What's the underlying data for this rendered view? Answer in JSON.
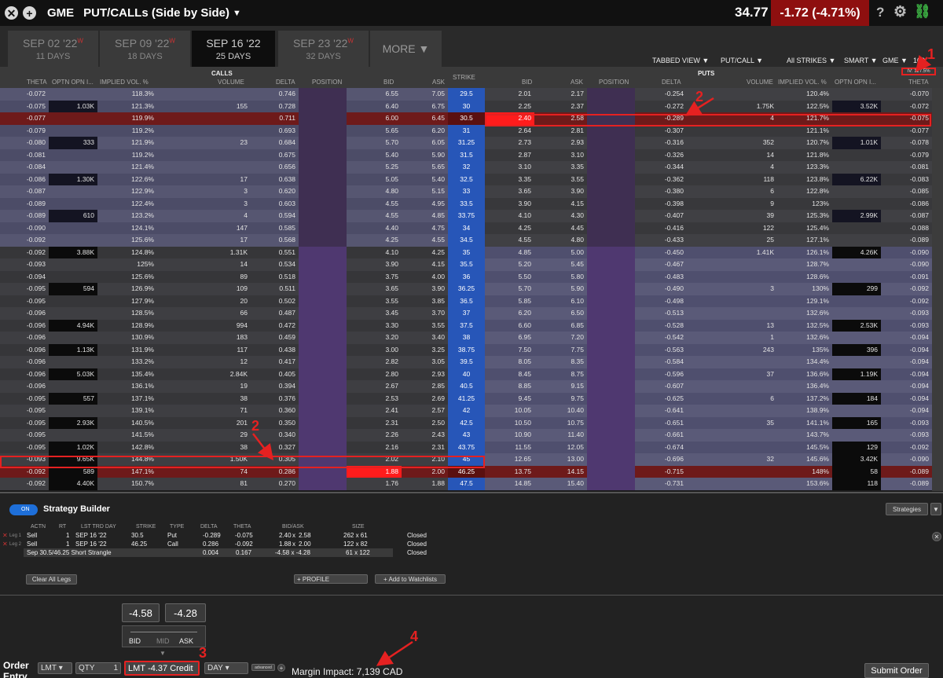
{
  "topbar": {
    "close_glyph": "✕",
    "add_glyph": "+",
    "symbol": "GME",
    "view": "PUT/CALLs (Side by Side)",
    "price": "34.77",
    "change": "-1.72 (-4.71%)",
    "help": "?"
  },
  "tabs": [
    {
      "date": "SEP 02 '22",
      "w": "W",
      "days": "11 DAYS"
    },
    {
      "date": "SEP 09 '22",
      "w": "W",
      "days": "18 DAYS"
    },
    {
      "date": "SEP 16 '22",
      "w": "",
      "days": "25 DAYS"
    },
    {
      "date": "SEP 23 '22",
      "w": "W",
      "days": "32 DAYS"
    }
  ],
  "more": "MORE ▼",
  "options": {
    "tabbed": "TABBED VIEW ▼",
    "putcall": "PUT/CALL ▼",
    "strikes": "All STRIKES ▼",
    "smart": "SMART ▼",
    "gme": "GME ▼",
    "mult": "100",
    "iv": "IV: 127.5%"
  },
  "headers": {
    "calls": "CALLS",
    "puts": "PUTS",
    "strike": "STRIKE",
    "c_theta": "THETA",
    "c_oi": "OPTN OPN I...",
    "c_iv": "IMPLIED VOL. %",
    "c_vol": "VOLUME",
    "c_delta": "DELTA",
    "c_pos": "POSITION",
    "c_bid": "BID",
    "c_ask": "ASK",
    "p_bid": "BID",
    "p_ask": "ASK",
    "p_pos": "POSITION",
    "p_delta": "DELTA",
    "p_vol": "VOLUME",
    "p_iv": "IMPLIED VOL. %",
    "p_oi": "OPTN OPN I...",
    "p_theta": "THETA"
  },
  "rows": [
    [
      "-0.072",
      "",
      "118.3%",
      "",
      "0.746",
      "6.55",
      "7.05",
      "29.5",
      "2.01",
      "2.17",
      "-0.254",
      "",
      "120.4%",
      "",
      "-0.070"
    ],
    [
      "-0.075",
      "1.03K",
      "121.3%",
      "155",
      "0.728",
      "6.40",
      "6.75",
      "30",
      "2.25",
      "2.37",
      "-0.272",
      "1.75K",
      "122.5%",
      "3.52K",
      "-0.072"
    ],
    [
      "-0.077",
      "",
      "119.9%",
      "",
      "0.711",
      "6.00",
      "6.45",
      "30.5",
      "2.40",
      "2.58",
      "-0.289",
      "4",
      "121.7%",
      "",
      "-0.075"
    ],
    [
      "-0.079",
      "",
      "119.2%",
      "",
      "0.693",
      "5.65",
      "6.20",
      "31",
      "2.64",
      "2.81",
      "-0.307",
      "",
      "121.1%",
      "",
      "-0.077"
    ],
    [
      "-0.080",
      "333",
      "121.9%",
      "23",
      "0.684",
      "5.70",
      "6.05",
      "31.25",
      "2.73",
      "2.93",
      "-0.316",
      "352",
      "120.7%",
      "1.01K",
      "-0.078"
    ],
    [
      "-0.081",
      "",
      "119.2%",
      "",
      "0.675",
      "5.40",
      "5.90",
      "31.5",
      "2.87",
      "3.10",
      "-0.326",
      "14",
      "121.8%",
      "",
      "-0.079"
    ],
    [
      "-0.084",
      "",
      "121.4%",
      "",
      "0.656",
      "5.25",
      "5.65",
      "32",
      "3.10",
      "3.35",
      "-0.344",
      "4",
      "123.3%",
      "",
      "-0.081"
    ],
    [
      "-0.086",
      "1.30K",
      "122.6%",
      "17",
      "0.638",
      "5.05",
      "5.40",
      "32.5",
      "3.35",
      "3.55",
      "-0.362",
      "118",
      "123.8%",
      "6.22K",
      "-0.083"
    ],
    [
      "-0.087",
      "",
      "122.9%",
      "3",
      "0.620",
      "4.80",
      "5.15",
      "33",
      "3.65",
      "3.90",
      "-0.380",
      "6",
      "122.8%",
      "",
      "-0.085"
    ],
    [
      "-0.089",
      "",
      "122.4%",
      "3",
      "0.603",
      "4.55",
      "4.95",
      "33.5",
      "3.90",
      "4.15",
      "-0.398",
      "9",
      "123%",
      "",
      "-0.086"
    ],
    [
      "-0.089",
      "610",
      "123.2%",
      "4",
      "0.594",
      "4.55",
      "4.85",
      "33.75",
      "4.10",
      "4.30",
      "-0.407",
      "39",
      "125.3%",
      "2.99K",
      "-0.087"
    ],
    [
      "-0.090",
      "",
      "124.1%",
      "147",
      "0.585",
      "4.40",
      "4.75",
      "34",
      "4.25",
      "4.45",
      "-0.416",
      "122",
      "125.4%",
      "",
      "-0.088"
    ],
    [
      "-0.092",
      "",
      "125.6%",
      "17",
      "0.568",
      "4.25",
      "4.55",
      "34.5",
      "4.55",
      "4.80",
      "-0.433",
      "25",
      "127.1%",
      "",
      "-0.089"
    ],
    [
      "-0.092",
      "3.88K",
      "124.8%",
      "1.31K",
      "0.551",
      "4.10",
      "4.25",
      "35",
      "4.85",
      "5.00",
      "-0.450",
      "1.41K",
      "126.1%",
      "4.26K",
      "-0.090"
    ],
    [
      "-0.093",
      "",
      "125%",
      "14",
      "0.534",
      "3.90",
      "4.15",
      "35.5",
      "5.20",
      "5.45",
      "-0.467",
      "",
      "128.7%",
      "",
      "-0.090"
    ],
    [
      "-0.094",
      "",
      "125.6%",
      "89",
      "0.518",
      "3.75",
      "4.00",
      "36",
      "5.50",
      "5.80",
      "-0.483",
      "",
      "128.6%",
      "",
      "-0.091"
    ],
    [
      "-0.095",
      "594",
      "126.9%",
      "109",
      "0.511",
      "3.65",
      "3.90",
      "36.25",
      "5.70",
      "5.90",
      "-0.490",
      "3",
      "130%",
      "299",
      "-0.092"
    ],
    [
      "-0.095",
      "",
      "127.9%",
      "20",
      "0.502",
      "3.55",
      "3.85",
      "36.5",
      "5.85",
      "6.10",
      "-0.498",
      "",
      "129.1%",
      "",
      "-0.092"
    ],
    [
      "-0.096",
      "",
      "128.5%",
      "66",
      "0.487",
      "3.45",
      "3.70",
      "37",
      "6.20",
      "6.50",
      "-0.513",
      "",
      "132.6%",
      "",
      "-0.093"
    ],
    [
      "-0.096",
      "4.94K",
      "128.9%",
      "994",
      "0.472",
      "3.30",
      "3.55",
      "37.5",
      "6.60",
      "6.85",
      "-0.528",
      "13",
      "132.5%",
      "2.53K",
      "-0.093"
    ],
    [
      "-0.096",
      "",
      "130.9%",
      "183",
      "0.459",
      "3.20",
      "3.40",
      "38",
      "6.95",
      "7.20",
      "-0.542",
      "1",
      "132.6%",
      "",
      "-0.094"
    ],
    [
      "-0.096",
      "1.13K",
      "131.9%",
      "117",
      "0.438",
      "3.00",
      "3.25",
      "38.75",
      "7.50",
      "7.75",
      "-0.563",
      "243",
      "135%",
      "396",
      "-0.094"
    ],
    [
      "-0.096",
      "",
      "133.2%",
      "12",
      "0.417",
      "2.82",
      "3.05",
      "39.5",
      "8.05",
      "8.35",
      "-0.584",
      "",
      "134.4%",
      "",
      "-0.094"
    ],
    [
      "-0.096",
      "5.03K",
      "135.4%",
      "2.84K",
      "0.405",
      "2.80",
      "2.93",
      "40",
      "8.45",
      "8.75",
      "-0.596",
      "37",
      "136.6%",
      "1.19K",
      "-0.094"
    ],
    [
      "-0.096",
      "",
      "136.1%",
      "19",
      "0.394",
      "2.67",
      "2.85",
      "40.5",
      "8.85",
      "9.15",
      "-0.607",
      "",
      "136.4%",
      "",
      "-0.094"
    ],
    [
      "-0.095",
      "557",
      "137.1%",
      "38",
      "0.376",
      "2.53",
      "2.69",
      "41.25",
      "9.45",
      "9.75",
      "-0.625",
      "6",
      "137.2%",
      "184",
      "-0.094"
    ],
    [
      "-0.095",
      "",
      "139.1%",
      "71",
      "0.360",
      "2.41",
      "2.57",
      "42",
      "10.05",
      "10.40",
      "-0.641",
      "",
      "138.9%",
      "",
      "-0.094"
    ],
    [
      "-0.095",
      "2.93K",
      "140.5%",
      "201",
      "0.350",
      "2.31",
      "2.50",
      "42.5",
      "10.50",
      "10.75",
      "-0.651",
      "35",
      "141.1%",
      "165",
      "-0.093"
    ],
    [
      "-0.095",
      "",
      "141.5%",
      "29",
      "0.340",
      "2.26",
      "2.43",
      "43",
      "10.90",
      "11.40",
      "-0.661",
      "",
      "143.7%",
      "",
      "-0.093"
    ],
    [
      "-0.095",
      "1.02K",
      "142.8%",
      "38",
      "0.327",
      "2.16",
      "2.31",
      "43.75",
      "11.55",
      "12.05",
      "-0.674",
      "",
      "145.5%",
      "129",
      "-0.092"
    ],
    [
      "-0.093",
      "9.65K",
      "144.8%",
      "1.50K",
      "0.305",
      "2.02",
      "2.10",
      "45",
      "12.65",
      "13.00",
      "-0.696",
      "32",
      "145.6%",
      "3.42K",
      "-0.090"
    ],
    [
      "-0.092",
      "589",
      "147.1%",
      "74",
      "0.286",
      "1.88",
      "2.00",
      "46.25",
      "13.75",
      "14.15",
      "-0.715",
      "",
      "148%",
      "58",
      "-0.089"
    ],
    [
      "-0.092",
      "4.40K",
      "150.7%",
      "81",
      "0.270",
      "1.76",
      "1.88",
      "47.5",
      "14.85",
      "15.40",
      "-0.731",
      "",
      "153.6%",
      "118",
      "-0.089"
    ]
  ],
  "strategy": {
    "on": "ON",
    "title": "Strategy Builder",
    "strategies_btn": "Strategies",
    "cols": {
      "actn": "ACTN",
      "rt": "RT",
      "lst": "LST TRD DAY",
      "strike": "STRIKE",
      "type": "TYPE",
      "delta": "DELTA",
      "theta": "THETA",
      "bidask": "BID/ASK",
      "size": "SIZE"
    },
    "legs": [
      {
        "tag": "Leg 1",
        "actn": "Sell",
        "rt": "1",
        "lst": "SEP 16 '22",
        "strike": "30.5",
        "type": "Put",
        "delta": "-0.289",
        "theta": "-0.075",
        "bid": "2.40",
        "ask": "2.58",
        "size": "262 x 61",
        "status": "Closed"
      },
      {
        "tag": "Leg 2",
        "actn": "Sell",
        "rt": "1",
        "lst": "SEP 16 '22",
        "strike": "46.25",
        "type": "Call",
        "delta": "0.286",
        "theta": "-0.092",
        "bid": "1.88",
        "ask": "2.00",
        "size": "122 x 82",
        "status": "Closed"
      }
    ],
    "combo": {
      "name": "Sep 30.5/46.25 Short Strangle",
      "delta": "0.004",
      "theta": "0.167",
      "bidask": "-4.58 x -4.28",
      "size": "61 x 122",
      "status": "Closed"
    },
    "clear": "Clear All Legs",
    "profile": "+ PROFILE",
    "watch": "+ Add to Watchlists"
  },
  "order": {
    "bidval": "-4.58",
    "askval": "-4.28",
    "bid": "BID",
    "mid": "MID",
    "ask": "ASK",
    "label1": "Order",
    "label2": "Entry",
    "type": "LMT",
    "qty_label": "QTY",
    "qty": "1",
    "lmt": "LMT",
    "price": "-4.37 Credit",
    "tif": "DAY",
    "adv": "advanced",
    "margin": "Margin Impact: 7,139 CAD",
    "submit": "Submit Order"
  },
  "annotations": {
    "a1": "1",
    "a2": "2",
    "a3": "3",
    "a4": "4"
  },
  "colors": {
    "accent": "#e52121",
    "strike": "#2756b8",
    "brandRed": "#8e0f0f"
  }
}
